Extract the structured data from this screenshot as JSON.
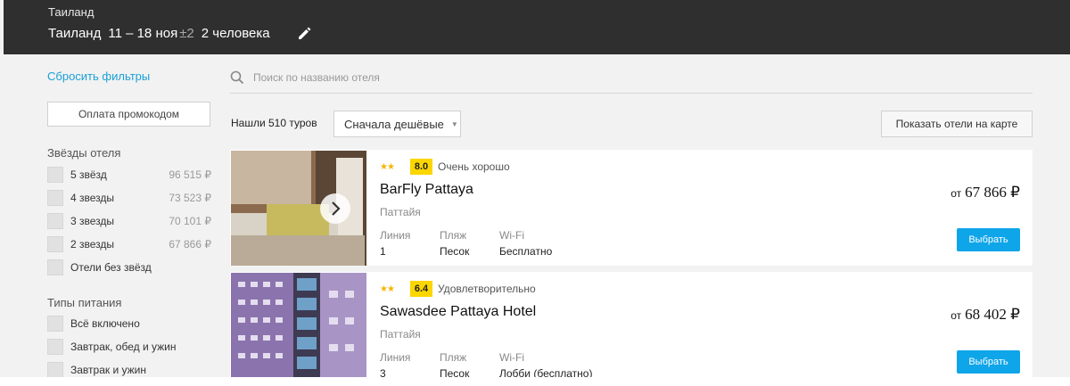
{
  "header": {
    "country": "Таиланд",
    "destination": "Таиланд",
    "dates": "11 – 18 ноя",
    "flex": "±2",
    "travelers": "2 человека",
    "edit_icon": "pencil-icon"
  },
  "sidebar": {
    "reset_label": "Сбросить фильтры",
    "promo_label": "Оплата промокодом",
    "stars_title": "Звёзды отеля",
    "stars": [
      {
        "label": "5 звёзд",
        "price": "96 515 ₽"
      },
      {
        "label": "4 звезды",
        "price": "73 523 ₽"
      },
      {
        "label": "3 звезды",
        "price": "70 101 ₽"
      },
      {
        "label": "2 звезды",
        "price": "67 866 ₽"
      },
      {
        "label": "Отели без звёзд",
        "price": ""
      }
    ],
    "meals_title": "Типы питания",
    "meals": [
      {
        "label": "Всё включено"
      },
      {
        "label": "Завтрак, обед и ужин"
      },
      {
        "label": "Завтрак и ужин"
      }
    ]
  },
  "main": {
    "search_placeholder": "Поиск по названию отеля",
    "search_icon": "search-icon",
    "found": "Нашли 510 туров",
    "sort_label": "Сначала дешёвые",
    "map_button": "Показать отели на карте",
    "hotels": [
      {
        "stars": "★★",
        "score": "8.0",
        "rating": "Очень хорошо",
        "name": "BarFly Pattaya",
        "city": "Паттайя",
        "line_label": "Линия",
        "line": "1",
        "beach_label": "Пляж",
        "beach": "Песок",
        "wifi_label": "Wi-Fi",
        "wifi": "Бесплатно",
        "price_prefix": "от",
        "price": "67 866 ₽",
        "select_label": "Выбрать"
      },
      {
        "stars": "★★",
        "score": "6.4",
        "rating": "Удовлетворительно",
        "name": "Sawasdee Pattaya Hotel",
        "city": "Паттайя",
        "line_label": "Линия",
        "line": "3",
        "beach_label": "Пляж",
        "beach": "Песок",
        "wifi_label": "Wi-Fi",
        "wifi": "Лобби (бесплатно)",
        "price_prefix": "от",
        "price": "68 402 ₽",
        "select_label": "Выбрать"
      }
    ]
  },
  "colors": {
    "header_bg": "#2f2f2f",
    "link": "#1aa0d8",
    "accent_button": "#0fa5e9",
    "score_badge": "#fcd600",
    "stars": "#f5b400"
  }
}
